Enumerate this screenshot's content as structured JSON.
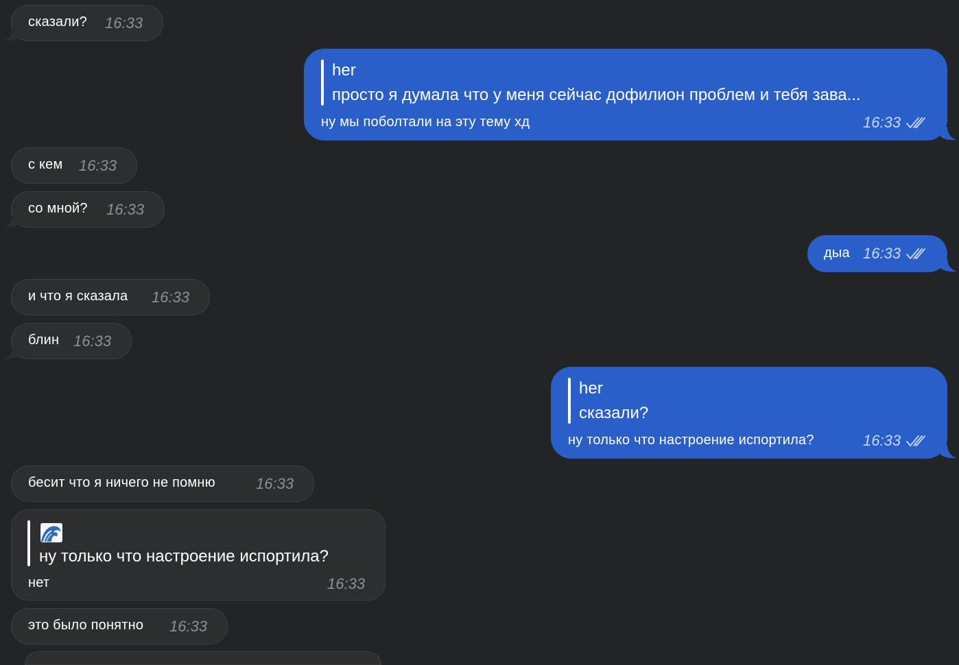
{
  "colors": {
    "background": "#222425",
    "incoming_bubble": "#2c2e30",
    "outgoing_bubble": "#2a5fc9",
    "incoming_time": "#8d9096",
    "outgoing_time": "#c9d8f5"
  },
  "messages": [
    {
      "direction": "in",
      "text": "сказали?",
      "time": "16:33"
    },
    {
      "direction": "out",
      "reply_author": "her",
      "reply_text": "просто я думала что у меня сейчас дофилион проблем и тебя зава...",
      "text": "ну мы поболтали на эту тему хд",
      "time": "16:33",
      "status_icon": "double-check-icon"
    },
    {
      "direction": "in",
      "text": "с кем",
      "time": "16:33"
    },
    {
      "direction": "in",
      "text": "со мной?",
      "time": "16:33"
    },
    {
      "direction": "out",
      "text": "дыа",
      "time": "16:33",
      "status_icon": "double-check-icon"
    },
    {
      "direction": "in",
      "text": "и что я сказала",
      "time": "16:33"
    },
    {
      "direction": "in",
      "text": "блин",
      "time": "16:33"
    },
    {
      "direction": "out",
      "reply_author": "her",
      "reply_text": "сказали?",
      "text": "ну только что настроение испортила?",
      "time": "16:33",
      "status_icon": "double-check-icon"
    },
    {
      "direction": "in",
      "text": "бесит что я ничего не помню",
      "time": "16:33"
    },
    {
      "direction": "in",
      "reply_icon": "wave-emoji-icon",
      "reply_text": "ну только что настроение испортила?",
      "text": "нет",
      "time": "16:33"
    },
    {
      "direction": "in",
      "text": "это было понятно",
      "time": "16:33"
    }
  ]
}
